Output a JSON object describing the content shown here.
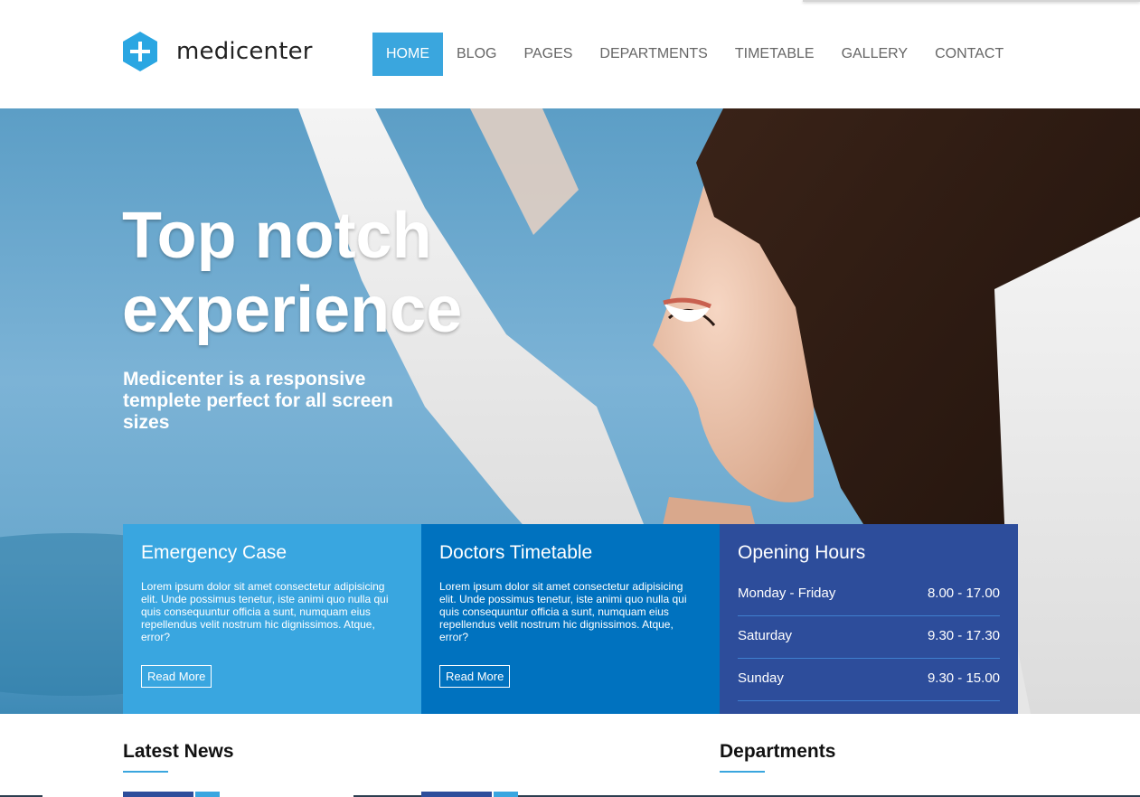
{
  "brand": {
    "name": "medicenter",
    "accent": "#3aa6de"
  },
  "nav": {
    "items": [
      "HOME",
      "BLOG",
      "PAGES",
      "DEPARTMENTS",
      "TIMETABLE",
      "GALLERY",
      "CONTACT"
    ],
    "active": "HOME"
  },
  "hero": {
    "title_line1": "Top notch",
    "title_line2": "experience",
    "subtitle": "Medicenter is a responsive templete perfect for all screen sizes"
  },
  "boxes": {
    "emergency": {
      "title": "Emergency Case",
      "body": "Lorem ipsum dolor sit amet consectetur adipisicing elit. Unde possimus tenetur, iste animi quo nulla qui quis consequuntur officia a sunt, numquam eius repellendus velit nostrum hic dignissimos. Atque, error?",
      "button": "Read More",
      "color": "#39a6e0"
    },
    "timetable": {
      "title": "Doctors Timetable",
      "body": "Lorem ipsum dolor sit amet consectetur adipisicing elit. Unde possimus tenetur, iste animi quo nulla qui quis consequuntur officia a sunt, numquam eius repellendus velit nostrum hic dignissimos. Atque, error?",
      "button": "Read More",
      "color": "#0072bf"
    },
    "hours": {
      "title": "Opening Hours",
      "color": "#2d4d9b",
      "rows": [
        {
          "day": "Monday - Friday",
          "time": "8.00 - 17.00"
        },
        {
          "day": "Saturday",
          "time": "9.30 - 17.30"
        },
        {
          "day": "Sunday",
          "time": "9.30 - 15.00"
        }
      ]
    }
  },
  "sections": {
    "latest_news": "Latest News",
    "departments": "Departments"
  }
}
